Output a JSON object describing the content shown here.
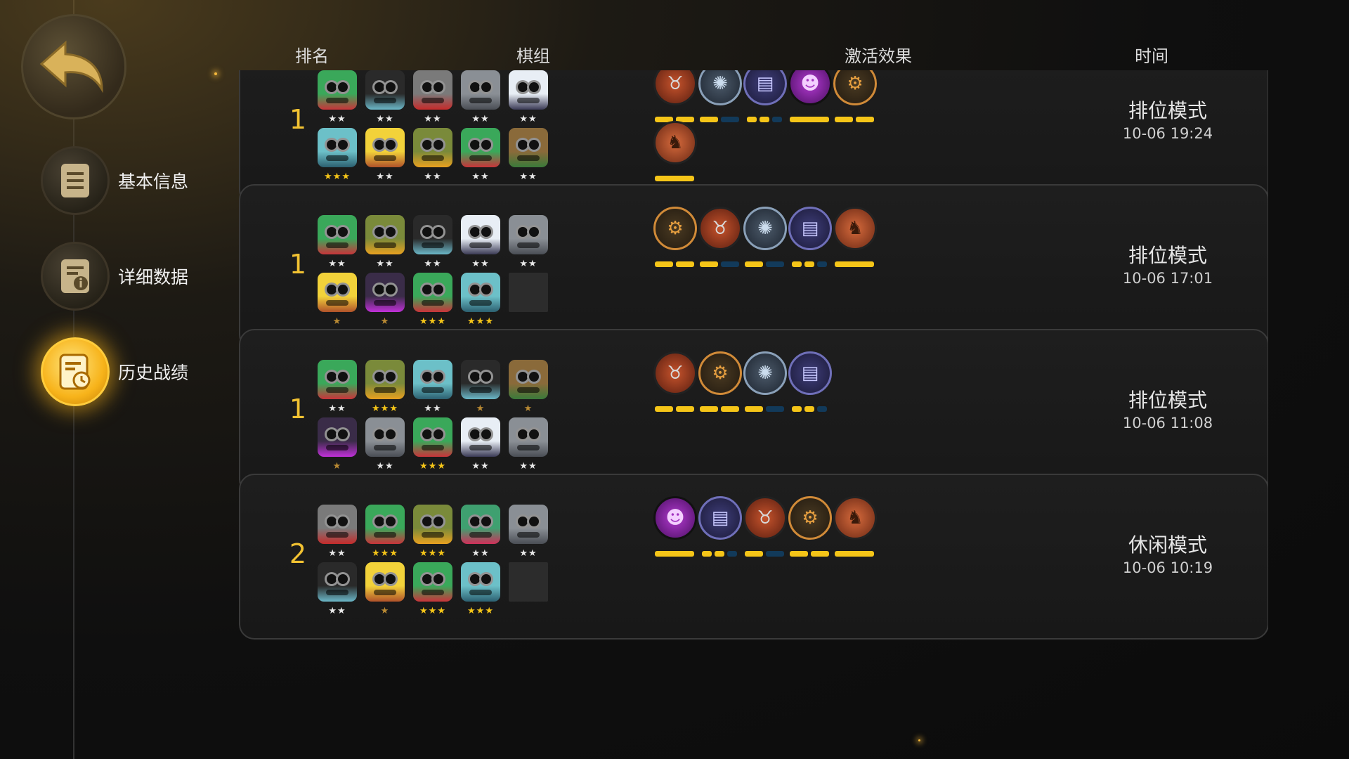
{
  "sidebar": {
    "back_icon": "back-arrow-icon",
    "items": [
      {
        "label": "基本信息",
        "icon": "document-icon",
        "active": false
      },
      {
        "label": "详细数据",
        "icon": "document-info-icon",
        "active": false
      },
      {
        "label": "历史战绩",
        "icon": "history-clock-icon",
        "active": true
      }
    ]
  },
  "headers": {
    "rank": "排名",
    "lineup": "棋组",
    "synergy": "激活效果",
    "time": "时间"
  },
  "matches": [
    {
      "rank": "1",
      "units": [
        {
          "color": "green",
          "stars": 2
        },
        {
          "color": "dark",
          "stars": 2
        },
        {
          "color": "gray",
          "stars": 2
        },
        {
          "color": "stone",
          "stars": 2
        },
        {
          "color": "white",
          "stars": 2
        },
        {
          "color": "teal",
          "stars": 3
        },
        {
          "color": "yellow",
          "stars": 2
        },
        {
          "color": "olive",
          "stars": 2
        },
        {
          "color": "green",
          "stars": 2
        },
        {
          "color": "brown",
          "stars": 2
        }
      ],
      "traits": [
        {
          "icon": "bull-icon",
          "style": "t-orange",
          "bars": [
            1,
            1
          ]
        },
        {
          "icon": "paw-icon",
          "style": "t-blue",
          "bars": [
            1,
            0
          ]
        },
        {
          "icon": "book-icon",
          "style": "t-purple",
          "bars": [
            1,
            1,
            0
          ]
        },
        {
          "icon": "demon-icon",
          "style": "t-violet",
          "bars": [
            1
          ]
        },
        {
          "icon": "gear-icon",
          "style": "t-gear",
          "bars": [
            1,
            1
          ]
        },
        {
          "icon": "helmet-icon",
          "style": "t-helm",
          "bars": [
            1
          ]
        }
      ],
      "mode": "排位模式",
      "time": "10-06 19:24"
    },
    {
      "rank": "1",
      "units": [
        {
          "color": "green",
          "stars": 2
        },
        {
          "color": "olive",
          "stars": 2
        },
        {
          "color": "dark",
          "stars": 2
        },
        {
          "color": "white",
          "stars": 2
        },
        {
          "color": "stone",
          "stars": 2
        },
        {
          "color": "yellow",
          "stars": 1
        },
        {
          "color": "purple",
          "stars": 1
        },
        {
          "color": "green",
          "stars": 3
        },
        {
          "color": "teal",
          "stars": 3
        },
        {
          "color": "empty",
          "stars": 0
        }
      ],
      "traits": [
        {
          "icon": "gear-icon",
          "style": "t-gear",
          "bars": [
            1,
            1
          ]
        },
        {
          "icon": "bull-icon",
          "style": "t-orange",
          "bars": [
            1,
            0
          ]
        },
        {
          "icon": "paw-icon",
          "style": "t-blue",
          "bars": [
            1,
            0
          ]
        },
        {
          "icon": "book-icon",
          "style": "t-purple",
          "bars": [
            1,
            1,
            0
          ]
        },
        {
          "icon": "helmet-icon",
          "style": "t-helm",
          "bars": [
            1
          ]
        }
      ],
      "mode": "排位模式",
      "time": "10-06 17:01"
    },
    {
      "rank": "1",
      "units": [
        {
          "color": "green",
          "stars": 2
        },
        {
          "color": "olive",
          "stars": 3
        },
        {
          "color": "teal",
          "stars": 2
        },
        {
          "color": "dark",
          "stars": 1
        },
        {
          "color": "brown",
          "stars": 1
        },
        {
          "color": "purple",
          "stars": 1
        },
        {
          "color": "stone",
          "stars": 2
        },
        {
          "color": "green",
          "stars": 3
        },
        {
          "color": "white",
          "stars": 2
        },
        {
          "color": "stone",
          "stars": 2
        }
      ],
      "traits": [
        {
          "icon": "bull-icon",
          "style": "t-orange",
          "bars": [
            1,
            1
          ]
        },
        {
          "icon": "gear-icon",
          "style": "t-gear",
          "bars": [
            1,
            1
          ]
        },
        {
          "icon": "paw-icon",
          "style": "t-blue",
          "bars": [
            1,
            0
          ]
        },
        {
          "icon": "book-icon",
          "style": "t-purple",
          "bars": [
            1,
            1,
            0
          ]
        }
      ],
      "mode": "排位模式",
      "time": "10-06 11:08"
    },
    {
      "rank": "2",
      "units": [
        {
          "color": "gray",
          "stars": 2
        },
        {
          "color": "green",
          "stars": 3
        },
        {
          "color": "olive",
          "stars": 3
        },
        {
          "color": "pink",
          "stars": 2
        },
        {
          "color": "stone",
          "stars": 2
        },
        {
          "color": "dark",
          "stars": 2
        },
        {
          "color": "yellow",
          "stars": 1
        },
        {
          "color": "green",
          "stars": 3
        },
        {
          "color": "teal",
          "stars": 3
        },
        {
          "color": "empty",
          "stars": 0
        }
      ],
      "traits": [
        {
          "icon": "demon-icon",
          "style": "t-violet",
          "bars": [
            1
          ]
        },
        {
          "icon": "book-icon",
          "style": "t-purple",
          "bars": [
            1,
            1,
            0
          ]
        },
        {
          "icon": "bull-icon",
          "style": "t-orange",
          "bars": [
            1,
            0
          ]
        },
        {
          "icon": "gear-icon",
          "style": "t-gear",
          "bars": [
            1,
            1
          ]
        },
        {
          "icon": "helmet-icon",
          "style": "t-helm",
          "bars": [
            1
          ]
        }
      ],
      "mode": "休闲模式",
      "time": "10-06 10:19"
    }
  ]
}
